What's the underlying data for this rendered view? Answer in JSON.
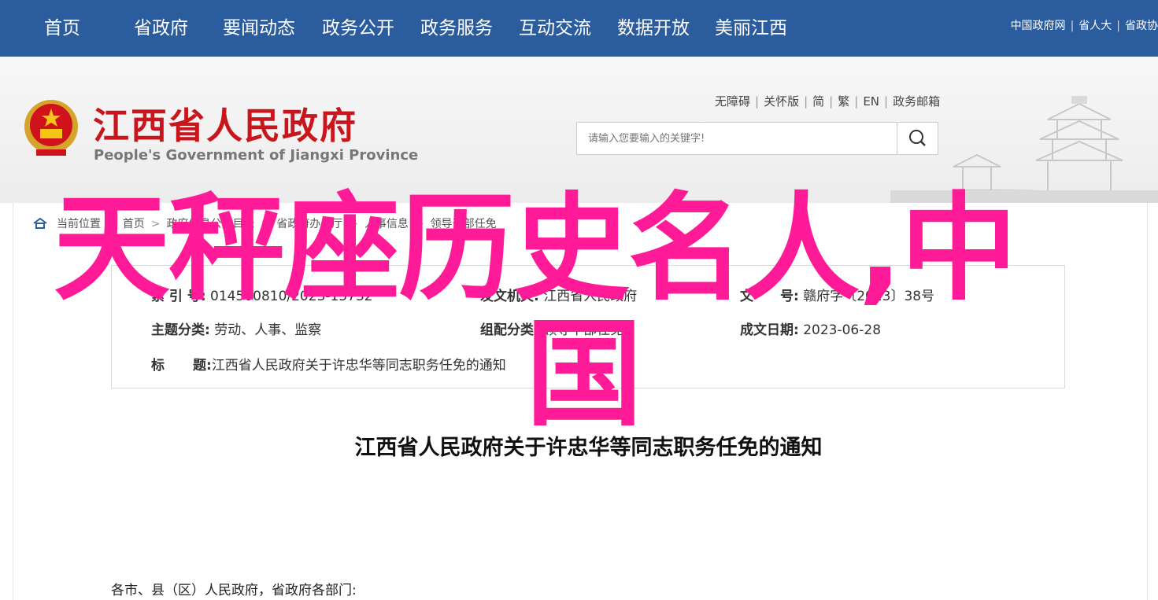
{
  "nav": {
    "items": [
      "首页",
      "省政府",
      "要闻动态",
      "政务公开",
      "政务服务",
      "互动交流",
      "数据开放",
      "美丽江西"
    ],
    "top_links": [
      "中国政府网",
      "省人大",
      "省政协"
    ]
  },
  "header": {
    "title": "江西省人民政府",
    "subtitle": "People's Government of Jiangxi Province",
    "util_links": [
      "无障碍",
      "关怀版",
      "简",
      "繁",
      "EN",
      "政务邮箱"
    ],
    "search_placeholder": "请输入您要输入的关键字!"
  },
  "breadcrumb": [
    "当前位置",
    "首页",
    "政府信息公开目录",
    "省政府办公厅",
    "人事信息",
    "领导干部任免"
  ],
  "meta": {
    "index_label": "索 引 号:",
    "index_value": "014500810/2023-15732",
    "issuer_label": "发文机关:",
    "issuer_value": "江西省人民政府",
    "docno_label": "文　　号:",
    "docno_value": "赣府字〔2023〕38号",
    "topic_label": "主题分类:",
    "topic_value": "劳动、人事、监察",
    "org_label": "组配分类:",
    "org_value": "领导干部任免",
    "date_label": "成文日期:",
    "date_value": "2023-06-28",
    "title_label_a": "标",
    "title_label_b": "题:",
    "title_value": "江西省人民政府关于许忠华等同志职务任免的通知"
  },
  "doc": {
    "title": "江西省人民政府关于许忠华等同志职务任免的通知",
    "salutation": "各市、县（区）人民政府，省政府各部门:"
  },
  "overlay": {
    "line1": "天秤座历史名人,中",
    "line2": "国",
    "color": "#ff1a97"
  },
  "colors": {
    "nav_bg": "#2b5c9e",
    "title_red": "#c9161c"
  }
}
